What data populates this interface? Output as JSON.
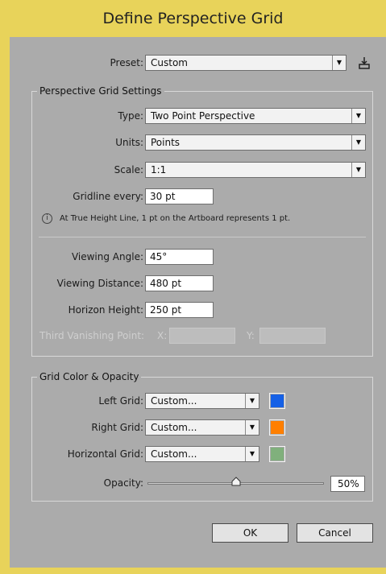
{
  "title": "Define Perspective Grid",
  "preset": {
    "label": "Preset:",
    "value": "Custom",
    "save_icon": "save-preset-icon"
  },
  "settings": {
    "group_title": "Perspective Grid Settings",
    "type": {
      "label": "Type:",
      "value": "Two Point Perspective"
    },
    "units": {
      "label": "Units:",
      "value": "Points"
    },
    "scale": {
      "label": "Scale:",
      "value": "1:1"
    },
    "gridline": {
      "label": "Gridline every:",
      "value": "30 pt"
    },
    "info_text": "At True Height Line, 1 pt on the Artboard represents 1 pt.",
    "viewing_angle": {
      "label": "Viewing Angle:",
      "value": "45°"
    },
    "viewing_distance": {
      "label": "Viewing Distance:",
      "value": "480 pt"
    },
    "horizon_height": {
      "label": "Horizon Height:",
      "value": "250 pt"
    },
    "third_vp": {
      "label": "Third Vanishing Point:",
      "x_label": "X:",
      "y_label": "Y:"
    }
  },
  "color_opacity": {
    "group_title": "Grid Color & Opacity",
    "left": {
      "label": "Left Grid:",
      "value": "Custom...",
      "color": "#1560e6"
    },
    "right": {
      "label": "Right Grid:",
      "value": "Custom...",
      "color": "#ff7f00"
    },
    "horizontal": {
      "label": "Horizontal Grid:",
      "value": "Custom...",
      "color": "#80b07c"
    },
    "opacity": {
      "label": "Opacity:",
      "value": "50%",
      "level": 0.5
    }
  },
  "buttons": {
    "ok": "OK",
    "cancel": "Cancel"
  },
  "colors": {
    "dialog_bg": "#ababab",
    "frame": "#e8d35a"
  }
}
